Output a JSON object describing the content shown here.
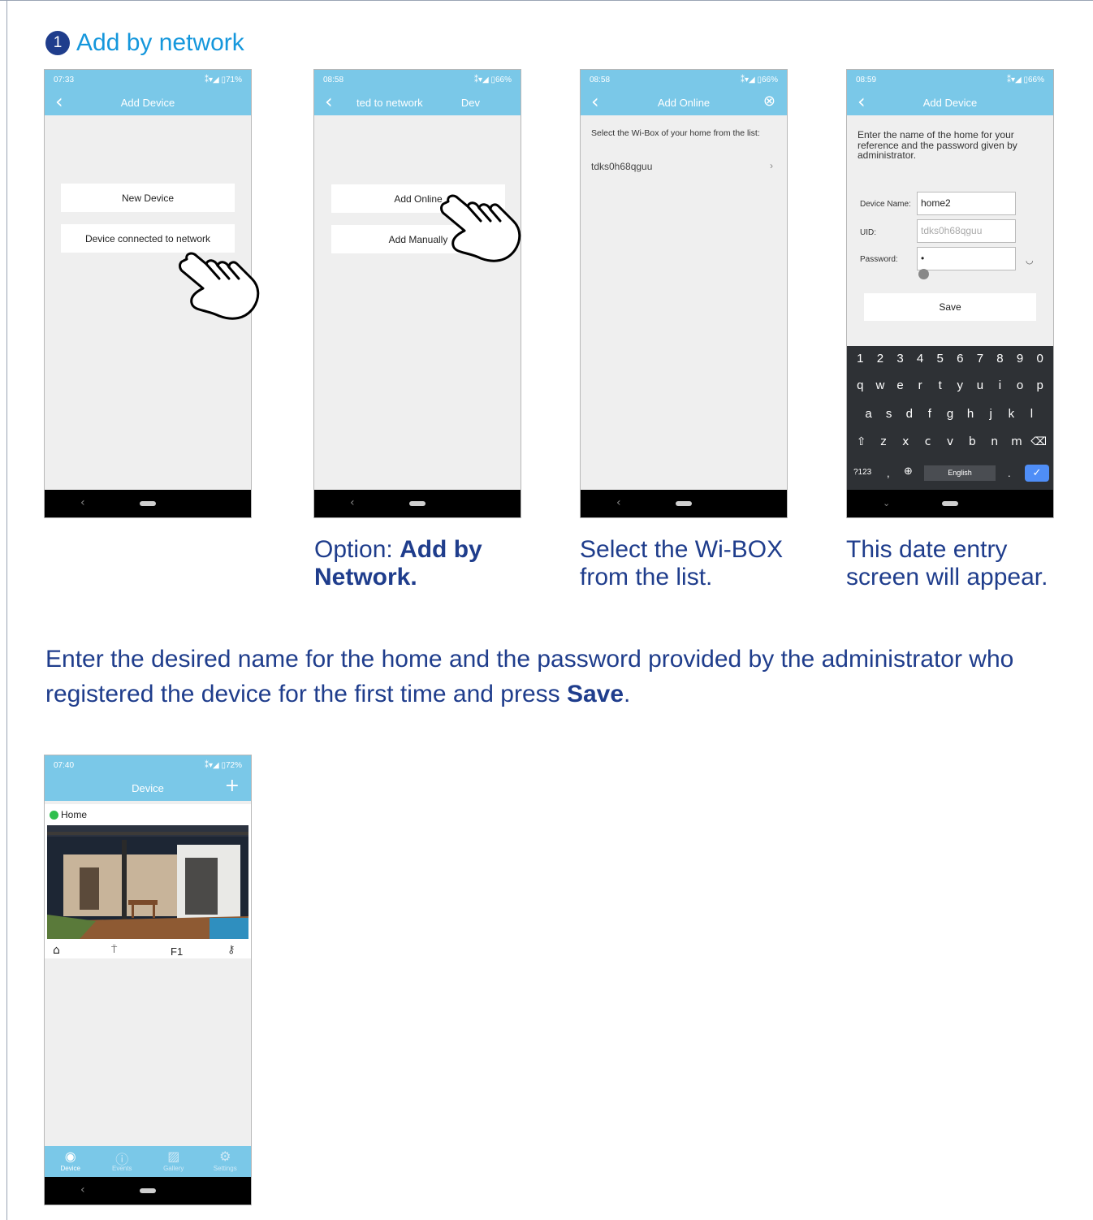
{
  "section": {
    "number": "1",
    "title": "Add by network"
  },
  "phone1": {
    "time": "07:33",
    "status_right": "⁑▾◢ ▯71%",
    "title": "Add Device",
    "buttons": [
      "New Device",
      "Device connected to network"
    ]
  },
  "phone2": {
    "time": "08:58",
    "status_right": "⁑▾◢ ▯66%",
    "title": "ted to network",
    "title_right": "Dev",
    "buttons": [
      "Add Online",
      "Add Manually"
    ]
  },
  "phone3": {
    "time": "08:58",
    "status_right": "⁑▾◢ ▯66%",
    "title": "Add Online",
    "instruction": "Select the Wi-Box of your home from the list:",
    "list_item": "tdks0h68qguu"
  },
  "phone4": {
    "time": "08:59",
    "status_right": "⁑▾◢ ▯66%",
    "title": "Add Device",
    "instruction": "Enter the name of the home for your reference and the password given by administrator.",
    "device_name_label": "Device Name:",
    "device_name_value": "home2",
    "uid_label": "UID:",
    "uid_value": "tdks0h68qguu",
    "password_label": "Password:",
    "password_value": "•",
    "save_label": "Save",
    "keyboard": {
      "row1": [
        "1",
        "2",
        "3",
        "4",
        "5",
        "6",
        "7",
        "8",
        "9",
        "0"
      ],
      "row2": [
        "q",
        "w",
        "e",
        "r",
        "t",
        "y",
        "u",
        "i",
        "o",
        "p"
      ],
      "row3": [
        "a",
        "s",
        "d",
        "f",
        "g",
        "h",
        "j",
        "k",
        "l"
      ],
      "row4": [
        "⇧",
        "z",
        "x",
        "c",
        "v",
        "b",
        "n",
        "m",
        "⌫"
      ],
      "symbols": "?123",
      "comma": ",",
      "space_label": "English",
      "period": "."
    }
  },
  "captions": {
    "c2_prefix": "Option: ",
    "c2_bold": "Add by Network.",
    "c3": "Select the Wi-BOX from the list.",
    "c4": "This date entry screen will appear."
  },
  "body": {
    "prefix": "Enter the desired name for the home and the password provided by the administrator who registered the device for the first time and press ",
    "bold": "Save",
    "suffix": "."
  },
  "phone5": {
    "time": "07:40",
    "status_right": "⁑▾◢ ▯72%",
    "title": "Device",
    "device_name": "Home",
    "control_f1": "F1",
    "tabs": [
      "Device",
      "Events",
      "Gallery",
      "Settings"
    ]
  },
  "colors": {
    "appbar": "#7ac8e8",
    "title_blue": "#1597dc",
    "text_navy": "#1f3d8c"
  }
}
